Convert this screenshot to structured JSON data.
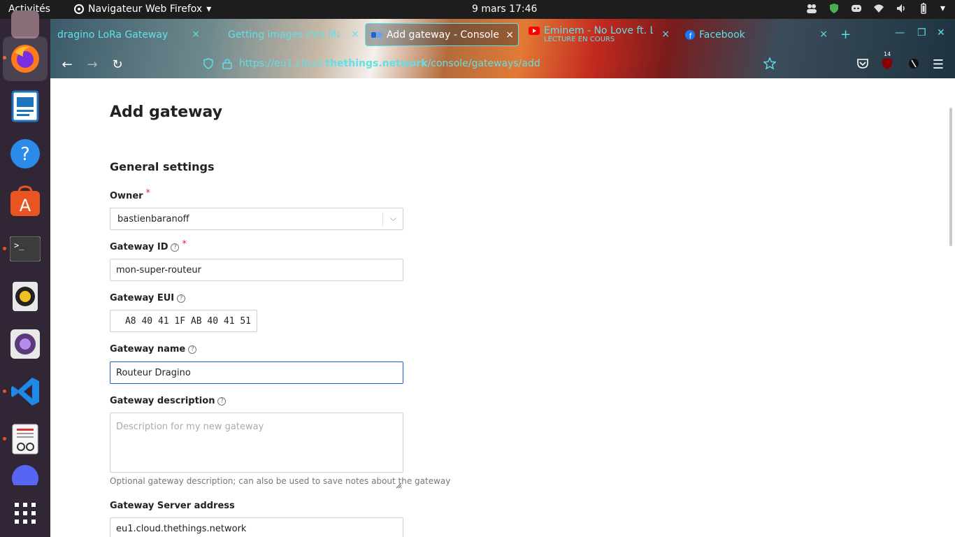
{
  "topbar": {
    "activities": "Activités",
    "app_menu": "Navigateur Web Firefox",
    "clock": "9 mars  17:46"
  },
  "tabs": [
    {
      "label": "dragino LoRa Gateway",
      "close": "×"
    },
    {
      "label": "Getting images into Ma",
      "close": "×"
    },
    {
      "label": "Add gateway - Console -",
      "close": "×"
    },
    {
      "label": "Eminem - No Love ft. Lil",
      "sublabel": "LECTURE EN COURS",
      "close": "×"
    },
    {
      "label": "Facebook",
      "close": "×"
    }
  ],
  "toolbar": {
    "new_tab": "+",
    "badge_count": "14"
  },
  "url": {
    "prefix": "https://eu1.cloud.",
    "host": "thethings.network",
    "path": "/console/gateways/add"
  },
  "page": {
    "title": "Add gateway",
    "section": "General settings",
    "owner": {
      "label": "Owner",
      "required": "*",
      "value": "bastienbaranoff"
    },
    "gateway_id": {
      "label": "Gateway ID",
      "required": "*",
      "value": "mon-super-routeur"
    },
    "gateway_eui": {
      "label": "Gateway EUI",
      "value": "A8 40 41 1F AB 40 41 51"
    },
    "gateway_name": {
      "label": "Gateway name",
      "value": "Routeur Dragino"
    },
    "gateway_description": {
      "label": "Gateway description",
      "placeholder": "Description for my new gateway",
      "hint": "Optional gateway description; can also be used to save notes about the gateway"
    },
    "server_address": {
      "label": "Gateway Server address",
      "value": "eu1.cloud.thethings.network"
    }
  },
  "colors": {
    "accent_cyan": "#5fe0e8",
    "focus_blue": "#1a5bd6",
    "required_red": "#e0223a",
    "dock_bg": "#302636",
    "topbar_bg": "#1d1d1d"
  }
}
